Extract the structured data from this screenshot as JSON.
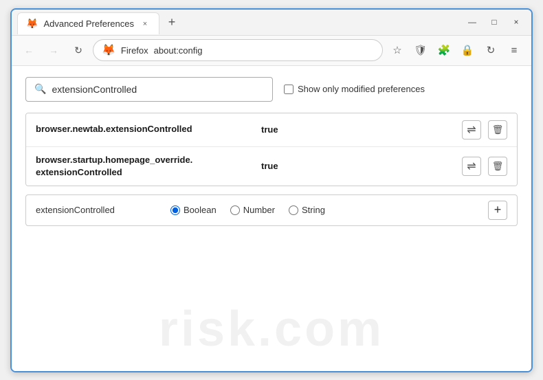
{
  "window": {
    "title": "Advanced Preferences",
    "tab_label": "Advanced Preferences",
    "close_icon": "×",
    "minimize_icon": "—",
    "maximize_icon": "□",
    "new_tab_icon": "+"
  },
  "nav": {
    "back_icon": "←",
    "forward_icon": "→",
    "reload_icon": "↻",
    "browser_name": "Firefox",
    "url": "about:config",
    "bookmark_icon": "☆",
    "shield_icon": "🛡",
    "extension_icon": "🧩",
    "lock_icon": "🔒",
    "sync_icon": "↻",
    "menu_icon": "≡"
  },
  "search": {
    "placeholder": "extensionControlled",
    "value": "extensionControlled",
    "show_modified_label": "Show only modified preferences"
  },
  "preferences": [
    {
      "name": "browser.newtab.extensionControlled",
      "value": "true"
    },
    {
      "name": "browser.startup.homepage_override.\nextensionControlled",
      "name_line1": "browser.startup.homepage_override.",
      "name_line2": "extensionControlled",
      "value": "true",
      "multiline": true
    }
  ],
  "new_pref": {
    "name": "extensionControlled",
    "types": [
      {
        "id": "boolean",
        "label": "Boolean",
        "checked": true
      },
      {
        "id": "number",
        "label": "Number",
        "checked": false
      },
      {
        "id": "string",
        "label": "String",
        "checked": false
      }
    ],
    "add_icon": "+"
  },
  "watermark": {
    "text": "risk.com"
  }
}
